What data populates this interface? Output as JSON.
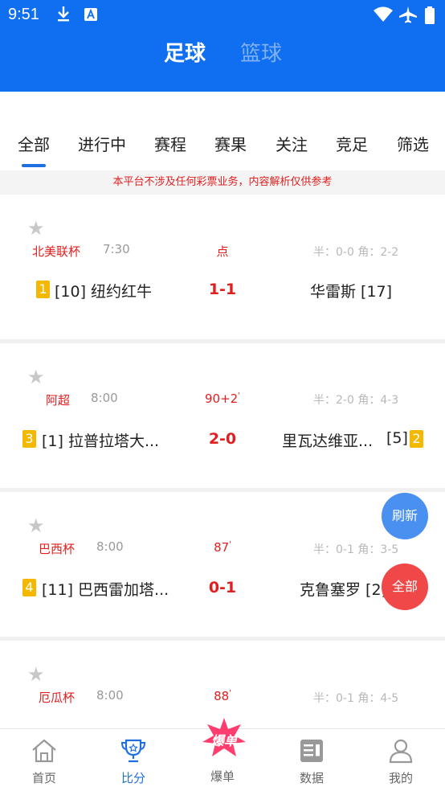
{
  "status_bar": {
    "time": "9:51"
  },
  "sport_tabs": [
    {
      "label": "足球"
    },
    {
      "label": "篮球"
    }
  ],
  "main_tabs": [
    {
      "label": "全部"
    },
    {
      "label": "进行中"
    },
    {
      "label": "赛程"
    },
    {
      "label": "赛果"
    },
    {
      "label": "关注"
    },
    {
      "label": "竞足"
    },
    {
      "label": "筛选"
    }
  ],
  "notice": "本平台不涉及任何彩票业务，内容解析仅供参考",
  "matches": [
    {
      "league": "北美联杯",
      "time": "7:30",
      "minute": "点",
      "stats": "半：0-0 角：2-2",
      "home_rank_badge": "1",
      "home": "[10] 纽约红牛",
      "score": "1-1",
      "away": "华雷斯 [17]",
      "away_rank_badge": ""
    },
    {
      "league": "阿超",
      "time": "8:00",
      "minute": "90+2",
      "stats": "半：2-0 角：4-3",
      "home_rank_badge": "3",
      "home": "[1] 拉普拉塔大...",
      "score": "2-0",
      "away": "里瓦达维亚...",
      "away_rank": "[5]",
      "away_rank_badge": "2"
    },
    {
      "league": "巴西杯",
      "time": "8:00",
      "minute": "87",
      "stats": "半：0-1 角：3-5",
      "home_rank_badge": "4",
      "home": "[11] 巴西雷加塔...",
      "score": "0-1",
      "away": "克鲁塞罗 [2]",
      "away_rank_badge": ""
    },
    {
      "league": "厄瓜杯",
      "time": "8:00",
      "minute": "88",
      "stats": "半：0-1 角：4-5"
    }
  ],
  "fabs": {
    "refresh": "刷新",
    "all": "全部"
  },
  "bottom_nav": [
    {
      "label": "首页",
      "icon": "home-icon"
    },
    {
      "label": "比分",
      "icon": "trophy-icon"
    },
    {
      "label": "爆单",
      "icon": "baodan-icon",
      "badge_text": "爆单"
    },
    {
      "label": "数据",
      "icon": "data-icon"
    },
    {
      "label": "我的",
      "icon": "profile-icon"
    }
  ],
  "colors": {
    "primary": "#0f6ff0",
    "active_blue": "#1f6fe0",
    "score_red": "#e02020",
    "badge_yellow": "#f5b800",
    "fab_blue": "#4a90f0",
    "fab_red": "#f04848"
  }
}
